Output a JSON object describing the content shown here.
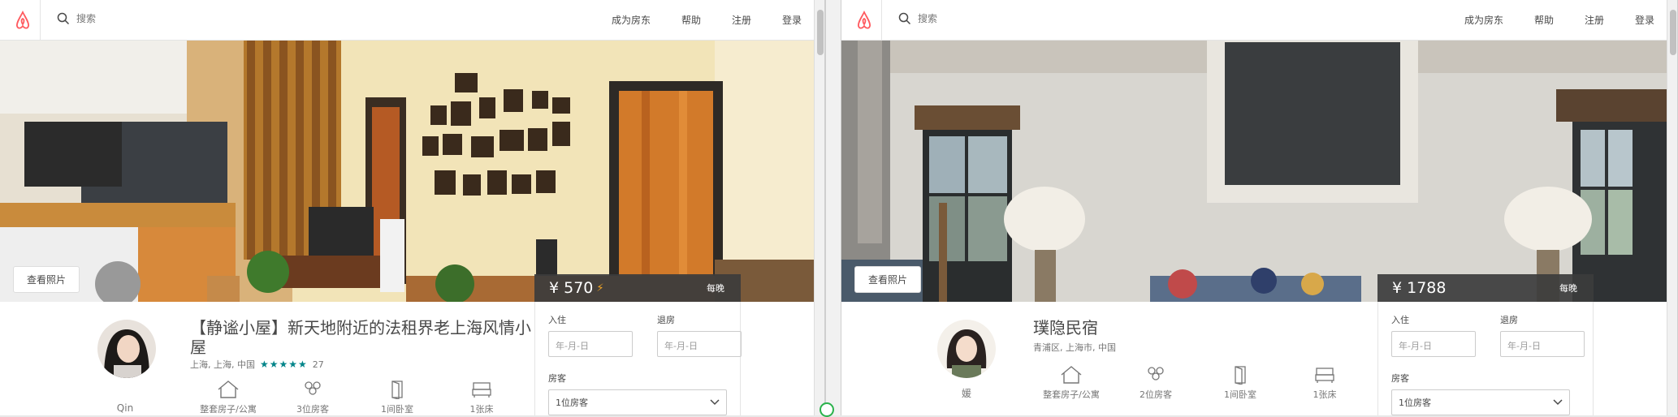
{
  "left": {
    "nav": {
      "search_placeholder": "搜索",
      "links": [
        "成为房东",
        "帮助",
        "注册",
        "登录"
      ]
    },
    "hero": {
      "view_photos": "查看照片"
    },
    "price": {
      "amount": "¥ 570",
      "per": "每晚"
    },
    "booking": {
      "checkin_label": "入住",
      "checkout_label": "退房",
      "date_placeholder": "年-月-日",
      "guests_label": "房客",
      "guests_value": "1位房客"
    },
    "host": {
      "name": "Qin"
    },
    "listing": {
      "title": "【静谧小屋】新天地附近的法租界老上海风情小屋",
      "location": "上海, 上海, 中国",
      "rating": "★★★★★",
      "reviews": "27",
      "amenities": [
        "整套房子/公寓",
        "3位房客",
        "1间卧室",
        "1张床"
      ]
    }
  },
  "right": {
    "nav": {
      "search_placeholder": "搜索",
      "links": [
        "成为房东",
        "帮助",
        "注册",
        "登录"
      ]
    },
    "hero": {
      "view_photos": "查看照片"
    },
    "price": {
      "amount": "¥ 1788",
      "per": "每晚"
    },
    "booking": {
      "checkin_label": "入住",
      "checkout_label": "退房",
      "date_placeholder": "年-月-日",
      "guests_label": "房客",
      "guests_value": "1位房客"
    },
    "host": {
      "name": "媛"
    },
    "listing": {
      "title": "璞隐民宿",
      "location": "青浦区, 上海市, 中国",
      "amenities": [
        "整套房子/公寓",
        "2位房客",
        "1间卧室",
        "1张床"
      ]
    }
  },
  "colors": {
    "brand": "#FF5A5F",
    "star": "#008489",
    "price_bar": "#3c3c3c"
  },
  "icons": [
    "airbnb-logo-icon",
    "search-icon",
    "house-icon",
    "guests-icon",
    "door-icon",
    "bed-icon",
    "chevron-down-icon"
  ]
}
